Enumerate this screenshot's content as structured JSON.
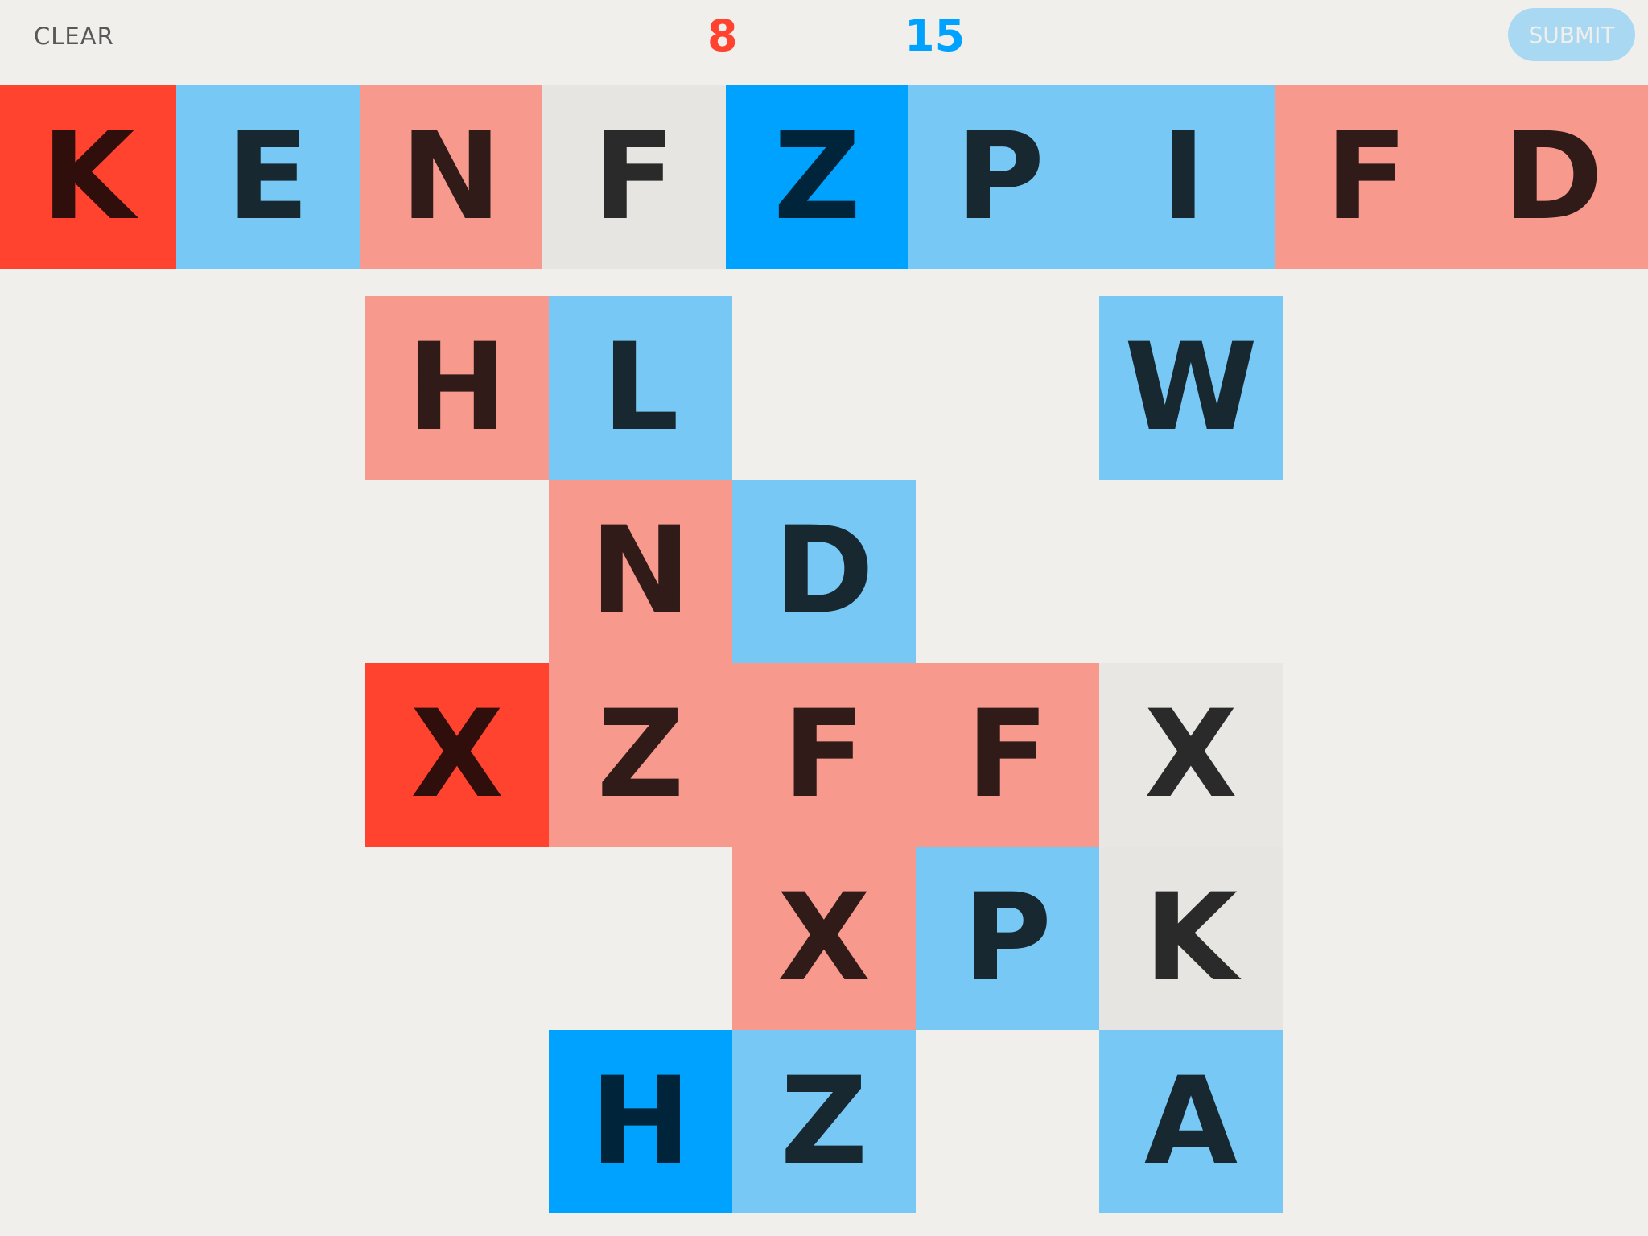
{
  "header": {
    "clear_label": "CLEAR",
    "score_red": "8",
    "score_blue": "15",
    "submit_label": "SUBMIT"
  },
  "colors": {
    "background": "#F0EFEC",
    "clear_text": "#585858",
    "red": "#FF432F",
    "pink": "#F7998D",
    "gray": "#E6E5E2",
    "blue": "#00A2FF",
    "light_blue": "#78C8F5",
    "letter_dark": "#182831",
    "submit_bg": "#A9D9F2"
  },
  "word_row": [
    {
      "letter": "K",
      "color": "red"
    },
    {
      "letter": "E",
      "color": "lblue"
    },
    {
      "letter": "N",
      "color": "pink"
    },
    {
      "letter": "F",
      "color": "gray"
    },
    {
      "letter": "Z",
      "color": "blue"
    },
    {
      "letter": "P",
      "color": "lblue"
    },
    {
      "letter": "I",
      "color": "lblue"
    },
    {
      "letter": "F",
      "color": "pink"
    },
    {
      "letter": "D",
      "color": "pink"
    }
  ],
  "board": [
    {
      "letter": "H",
      "color": "pink",
      "row": 0,
      "col": 0
    },
    {
      "letter": "L",
      "color": "lblue",
      "row": 0,
      "col": 1
    },
    {
      "letter": "W",
      "color": "lblue",
      "row": 0,
      "col": 4
    },
    {
      "letter": "N",
      "color": "pink",
      "row": 1,
      "col": 1
    },
    {
      "letter": "D",
      "color": "lblue",
      "row": 1,
      "col": 2
    },
    {
      "letter": "X",
      "color": "red",
      "row": 2,
      "col": 0
    },
    {
      "letter": "Z",
      "color": "pink",
      "row": 2,
      "col": 1
    },
    {
      "letter": "F",
      "color": "pink",
      "row": 2,
      "col": 2
    },
    {
      "letter": "F",
      "color": "pink",
      "row": 2,
      "col": 3
    },
    {
      "letter": "X",
      "color": "gray2",
      "row": 2,
      "col": 4
    },
    {
      "letter": "X",
      "color": "pink",
      "row": 3,
      "col": 2
    },
    {
      "letter": "P",
      "color": "lblue",
      "row": 3,
      "col": 3
    },
    {
      "letter": "K",
      "color": "gray",
      "row": 3,
      "col": 4
    },
    {
      "letter": "H",
      "color": "blue",
      "row": 4,
      "col": 1
    },
    {
      "letter": "Z",
      "color": "lblue",
      "row": 4,
      "col": 2
    },
    {
      "letter": "A",
      "color": "lblue",
      "row": 4,
      "col": 4
    }
  ]
}
